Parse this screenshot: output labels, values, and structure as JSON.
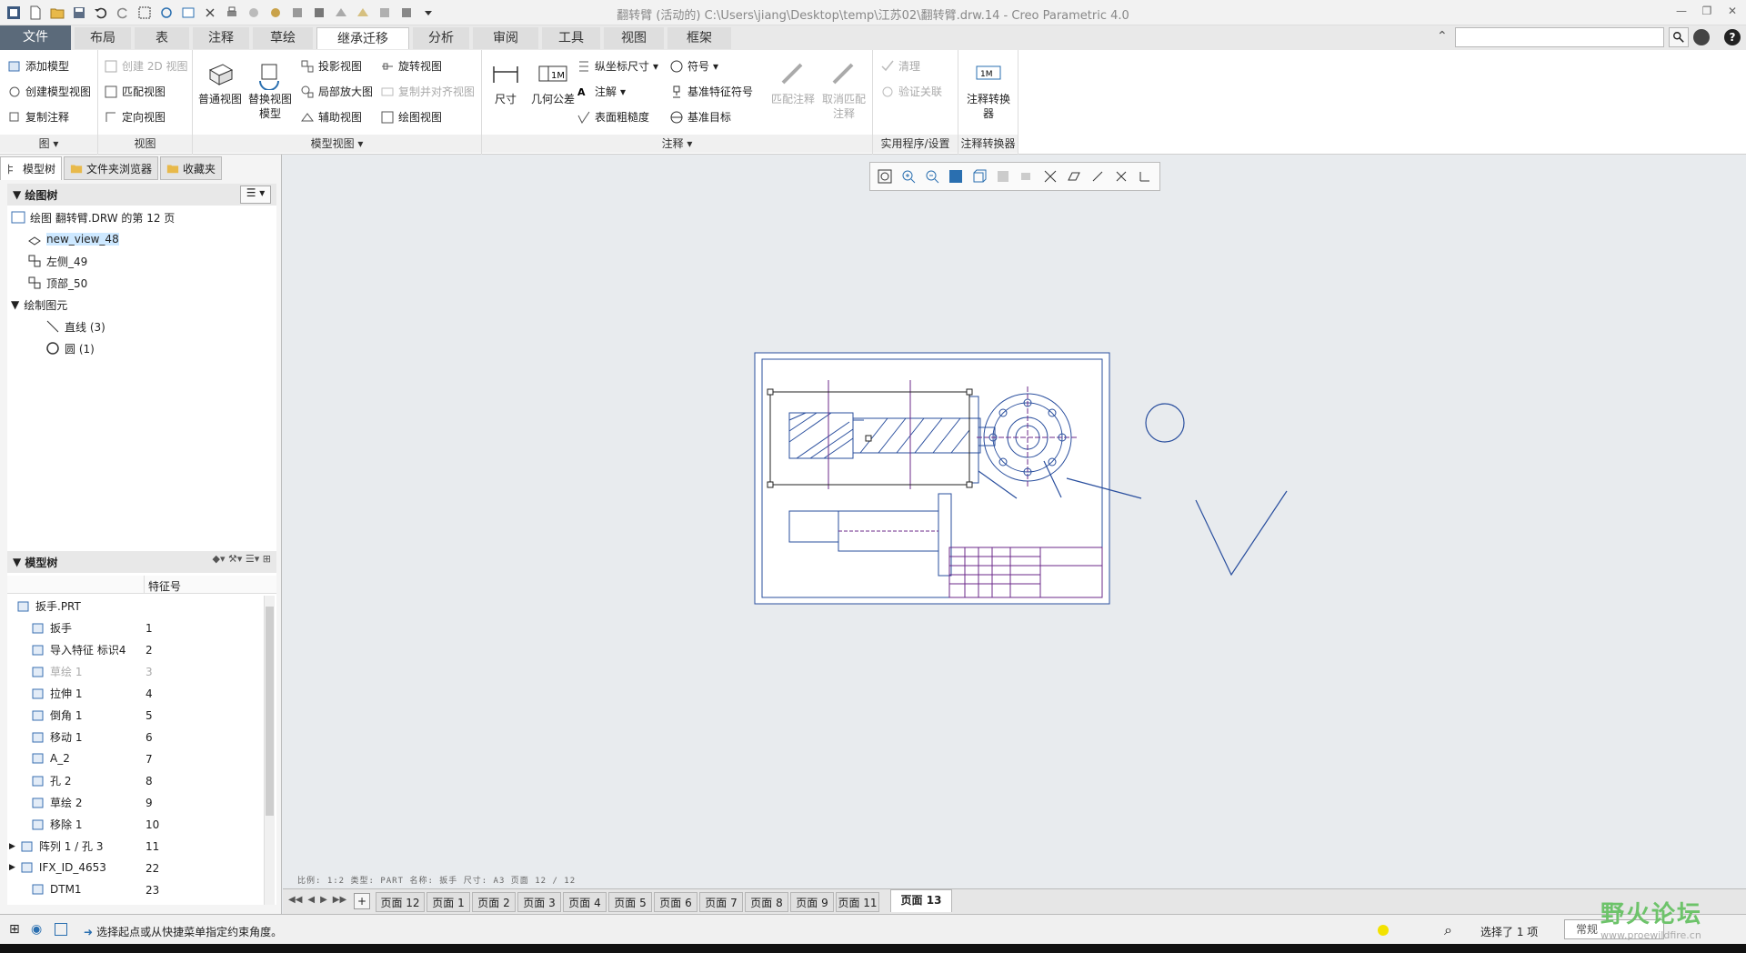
{
  "window": {
    "title": "翻转臂 (活动的) C:\\Users\\jiang\\Desktop\\temp\\江苏02\\翻转臂.drw.14 - Creo Parametric 4.0"
  },
  "tabs": [
    "文件",
    "布局",
    "表",
    "注释",
    "草绘",
    "继承迁移",
    "分析",
    "审阅",
    "工具",
    "视图",
    "框架"
  ],
  "ribbon": {
    "g1": {
      "items": [
        "添加模型",
        "创建模型视图",
        "复制注释"
      ],
      "label": "图"
    },
    "g2": {
      "items": [
        "创建 2D 视图",
        "匹配视图",
        "定向视图"
      ],
      "label": "视图"
    },
    "g3": {
      "big1": "普通视图",
      "big2a": "替换视图",
      "big2b": "模型",
      "items": [
        "投影视图",
        "局部放大图",
        "辅助视图",
        "旋转视图",
        "复制并对齐视图",
        "绘图视图"
      ],
      "label": "模型视图"
    },
    "g4": {
      "big1": "尺寸",
      "big2": "几何公差",
      "items": [
        "纵坐标尺寸",
        "注解",
        "表面粗糙度",
        "符号",
        "基准特征符号",
        "基准目标"
      ],
      "big3": "匹配注释",
      "big4a": "取消匹配",
      "big4b": "注释",
      "label": "注释"
    },
    "g5": {
      "items": [
        "清理",
        "验证关联"
      ],
      "label": "实用程序/设置"
    },
    "g6": {
      "big1a": "注释转换",
      "big1b": "器",
      "label": "注释转换器"
    }
  },
  "left": {
    "tabs": [
      "模型树",
      "文件夹浏览器",
      "收藏夹"
    ],
    "drawing_tree_title": "绘图树",
    "drawing_tree": [
      {
        "label": "绘图 翻转臂.DRW 的第 12 页"
      },
      {
        "label": "new_view_48"
      },
      {
        "label": "左侧_49"
      },
      {
        "label": "顶部_50"
      },
      {
        "label": "绘制图元"
      },
      {
        "label": "直线 (3)"
      },
      {
        "label": "圆 (1)"
      }
    ],
    "model_tree_title": "模型树",
    "column_header": "特征号",
    "model_tree": [
      {
        "name": "扳手.PRT",
        "id": ""
      },
      {
        "name": "扳手",
        "id": "1"
      },
      {
        "name": "导入特征 标识4",
        "id": "2"
      },
      {
        "name": "草绘 1",
        "id": "3"
      },
      {
        "name": "拉伸 1",
        "id": "4"
      },
      {
        "name": "倒角 1",
        "id": "5"
      },
      {
        "name": "移动 1",
        "id": "6"
      },
      {
        "name": "A_2",
        "id": "7"
      },
      {
        "name": "孔 2",
        "id": "8"
      },
      {
        "name": "草绘 2",
        "id": "9"
      },
      {
        "name": "移除 1",
        "id": "10"
      },
      {
        "name": "阵列 1 / 孔 3",
        "id": "11"
      },
      {
        "name": "IFX_ID_4653",
        "id": "22"
      },
      {
        "name": "DTM1",
        "id": "23"
      }
    ]
  },
  "canvas": {
    "info": "比例: 1:2   类型: PART   名称: 扳手   尺寸: A3   页面 12 / 12"
  },
  "pages": [
    "页面 12",
    "页面 1",
    "页面 2",
    "页面 3",
    "页面 4",
    "页面 5",
    "页面 6",
    "页面 7",
    "页面 8",
    "页面 9",
    "页面 11",
    "页面 13"
  ],
  "status": {
    "message": "选择起点或从快捷菜单指定约束角度。",
    "selected": "选择了 1 项",
    "filter": "常规"
  },
  "watermark": {
    "name": "野火论坛",
    "url": "www.proewildfire.cn"
  },
  "colors": {
    "accent": "#5b6a7a",
    "drawing": "#2a4f9e",
    "purple": "#6b2a8a",
    "selection": "#cde8ff"
  }
}
